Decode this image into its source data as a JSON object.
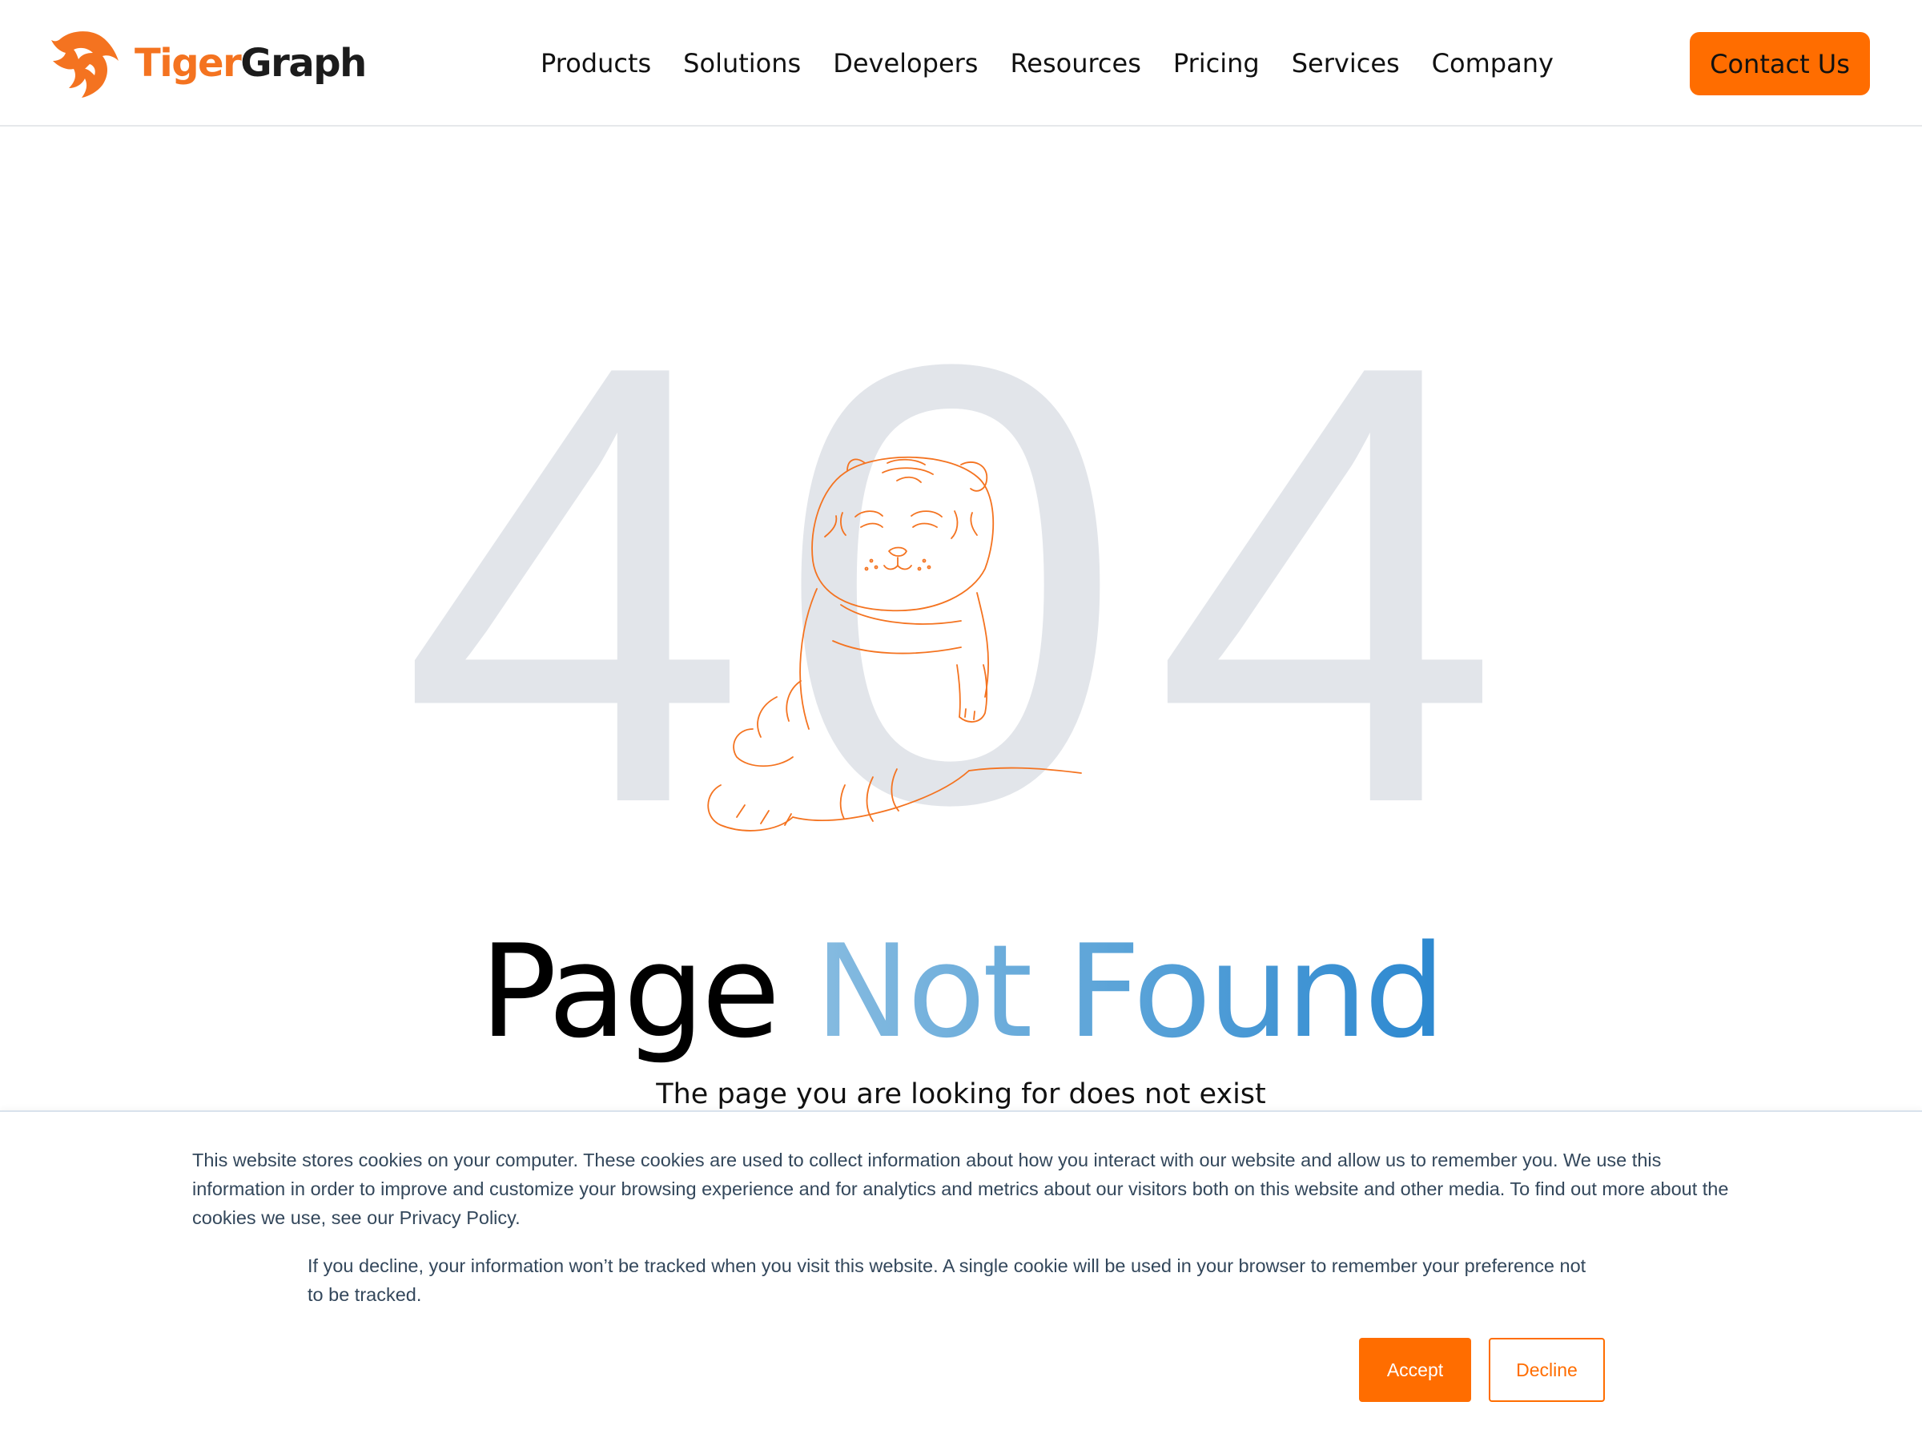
{
  "header": {
    "logo": {
      "text_part1": "Tiger",
      "text_part2": "Graph",
      "icon": "tiger-head-icon"
    },
    "nav": [
      {
        "label": "Products"
      },
      {
        "label": "Solutions"
      },
      {
        "label": "Developers"
      },
      {
        "label": "Resources"
      },
      {
        "label": "Pricing"
      },
      {
        "label": "Services"
      },
      {
        "label": "Company"
      }
    ],
    "contact_label": "Contact Us"
  },
  "error": {
    "code_digit1": "4",
    "code_digit2": "0",
    "code_digit3": "4",
    "illustration": "tiger-line-drawing",
    "title_part1": "Page ",
    "title_part2": "Not Found",
    "subtitle": "The page you are looking for does not exist"
  },
  "cookie_banner": {
    "text1": "This website stores cookies on your computer. These cookies are used to collect information about how you interact with our website and allow us to remember you. We use this information in order to improve and customize your browsing experience and for analytics and metrics about our visitors both on this website and other media. To find out more about the cookies we use, see our Privacy Policy.",
    "text2": "If you decline, your information won’t be tracked when you visit this website. A single cookie will be used in your browser to remember your preference not to be tracked.",
    "accept_label": "Accept",
    "decline_label": "Decline"
  },
  "colors": {
    "brand_orange": "#ff6d00",
    "digit_gray": "#e2e5ea",
    "title_blue_start": "#86bbe0",
    "title_blue_end": "#2c88d0",
    "cookie_text": "#33475b"
  }
}
